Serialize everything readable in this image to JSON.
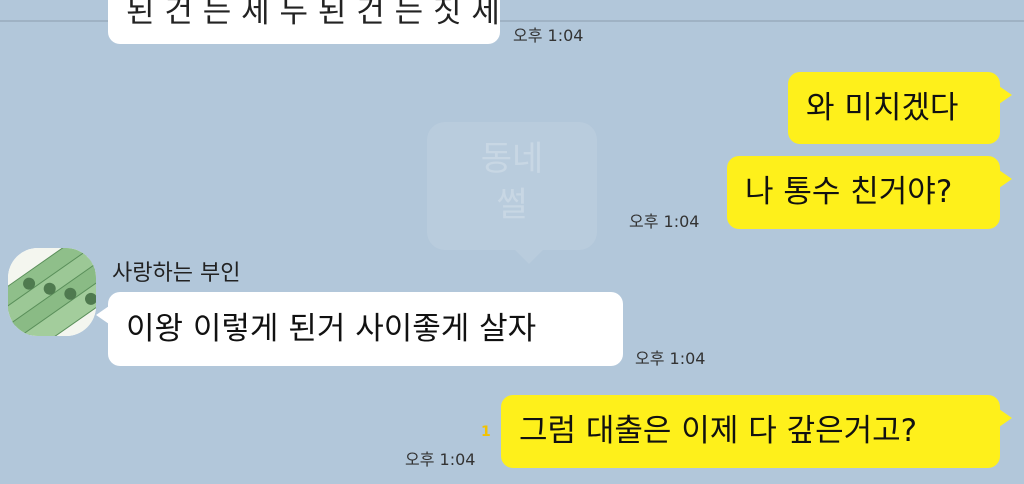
{
  "watermark": {
    "line1": "동네",
    "line2": "썰"
  },
  "messages": {
    "m0": {
      "text": "된 건 는 세 두 된 건 는 짓 세",
      "time": "오후 1:04"
    },
    "m1": {
      "text": "와 미치겠다"
    },
    "m2": {
      "text": "나 통수 친거야?",
      "time": "오후 1:04"
    },
    "m3": {
      "sender": "사랑하는 부인",
      "text": "이왕 이렇게 된거 사이좋게 살자",
      "time": "오후 1:04"
    },
    "m4": {
      "text": "그럼 대출은 이제 다 갚은거고?",
      "time": "오후 1:04",
      "unread": "1"
    }
  },
  "colors": {
    "background": "#b2c7da",
    "incoming_bubble": "#ffffff",
    "outgoing_bubble": "#fef01b",
    "unread_count": "#f2c200"
  },
  "icons": {
    "avatar": "banknote-stack-avatar"
  }
}
